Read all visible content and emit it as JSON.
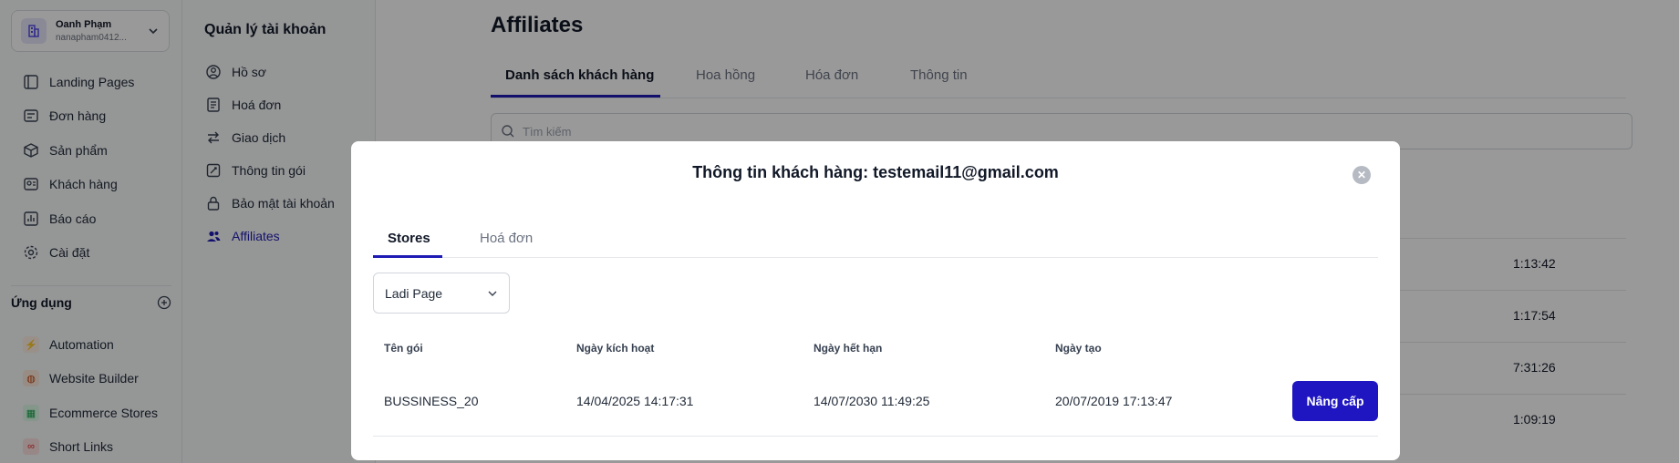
{
  "user": {
    "name": "Oanh Phạm",
    "email": "nanapham0412..."
  },
  "nav": {
    "items": [
      {
        "label": "Landing Pages",
        "icon": "landing-pages-icon"
      },
      {
        "label": "Đơn hàng",
        "icon": "orders-icon"
      },
      {
        "label": "Sản phẩm",
        "icon": "products-icon"
      },
      {
        "label": "Khách hàng",
        "icon": "customers-icon"
      },
      {
        "label": "Báo cáo",
        "icon": "reports-icon"
      },
      {
        "label": "Cài đặt",
        "icon": "gear-icon"
      }
    ],
    "apps_title": "Ứng dụng",
    "apps": [
      {
        "label": "Automation",
        "icon": "automation-icon",
        "color": "#f97316"
      },
      {
        "label": "Website Builder",
        "icon": "website-builder-icon",
        "color": "#c2410c"
      },
      {
        "label": "Ecommerce Stores",
        "icon": "store-icon",
        "color": "#16a34a"
      },
      {
        "label": "Short Links",
        "icon": "link-icon",
        "color": "#dc2626"
      }
    ]
  },
  "settings": {
    "title": "Quản lý tài khoản",
    "items": [
      {
        "label": "Hồ sơ",
        "icon": "profile-icon"
      },
      {
        "label": "Hoá đơn",
        "icon": "invoice-icon"
      },
      {
        "label": "Giao dịch",
        "icon": "transaction-icon"
      },
      {
        "label": "Thông tin gói",
        "icon": "package-info-icon"
      },
      {
        "label": "Bảo mật tài khoản",
        "icon": "lock-icon"
      },
      {
        "label": "Affiliates",
        "icon": "users-icon",
        "active": true
      }
    ]
  },
  "page": {
    "title": "Affiliates",
    "tabs": [
      "Danh sách khách hàng",
      "Hoa hồng",
      "Hóa đơn",
      "Thông tin"
    ],
    "search_placeholder": "Tìm kiếm",
    "bg_times": [
      "1:13:42",
      "1:17:54",
      "7:31:26",
      "1:09:19"
    ]
  },
  "modal": {
    "title": "Thông tin khách hàng: testemail11@gmail.com",
    "tabs": [
      "Stores",
      "Hoá đơn"
    ],
    "select_value": "Ladi Page",
    "columns": [
      "Tên gói",
      "Ngày kích hoạt",
      "Ngày hết hạn",
      "Ngày tạo"
    ],
    "row": {
      "package": "BUSSINESS_20",
      "activated": "14/04/2025 14:17:31",
      "expires": "14/07/2030 11:49:25",
      "created": "20/07/2019 17:13:47"
    },
    "upgrade_label": "Nâng cấp"
  },
  "colors": {
    "accent": "#1e1bb5",
    "button": "#1f16c1"
  }
}
